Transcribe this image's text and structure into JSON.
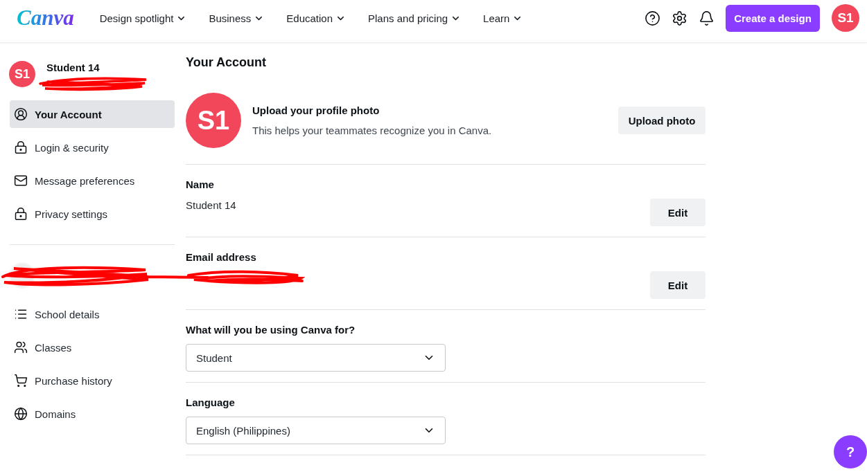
{
  "header": {
    "logo": "Canva",
    "nav": [
      "Design spotlight",
      "Business",
      "Education",
      "Plans and pricing",
      "Learn"
    ],
    "create_button": "Create a design",
    "avatar": "S1"
  },
  "sidebar": {
    "profile": {
      "avatar": "S1",
      "name": "Student 14"
    },
    "account_items": [
      {
        "label": "Your Account",
        "selected": true
      },
      {
        "label": "Login & security",
        "selected": false
      },
      {
        "label": "Message preferences",
        "selected": false
      },
      {
        "label": "Privacy settings",
        "selected": false
      }
    ],
    "school_items": [
      {
        "label": "School details",
        "selected": false
      },
      {
        "label": "Classes",
        "selected": false
      },
      {
        "label": "Purchase history",
        "selected": false
      },
      {
        "label": "Domains",
        "selected": false
      }
    ]
  },
  "main": {
    "title": "Your Account",
    "photo": {
      "avatar": "S1",
      "title": "Upload your profile photo",
      "description": "This helps your teammates recognize you in Canva.",
      "button": "Upload photo"
    },
    "fields": [
      {
        "kind": "text",
        "label": "Name",
        "value": "Student 14",
        "button": "Edit"
      },
      {
        "kind": "text",
        "label": "Email address",
        "button": "Edit"
      },
      {
        "kind": "select",
        "label": "What will you be using Canva for?",
        "value": "Student"
      },
      {
        "kind": "select",
        "label": "Language",
        "value": "English (Philippines)"
      }
    ]
  },
  "help_button": "?"
}
